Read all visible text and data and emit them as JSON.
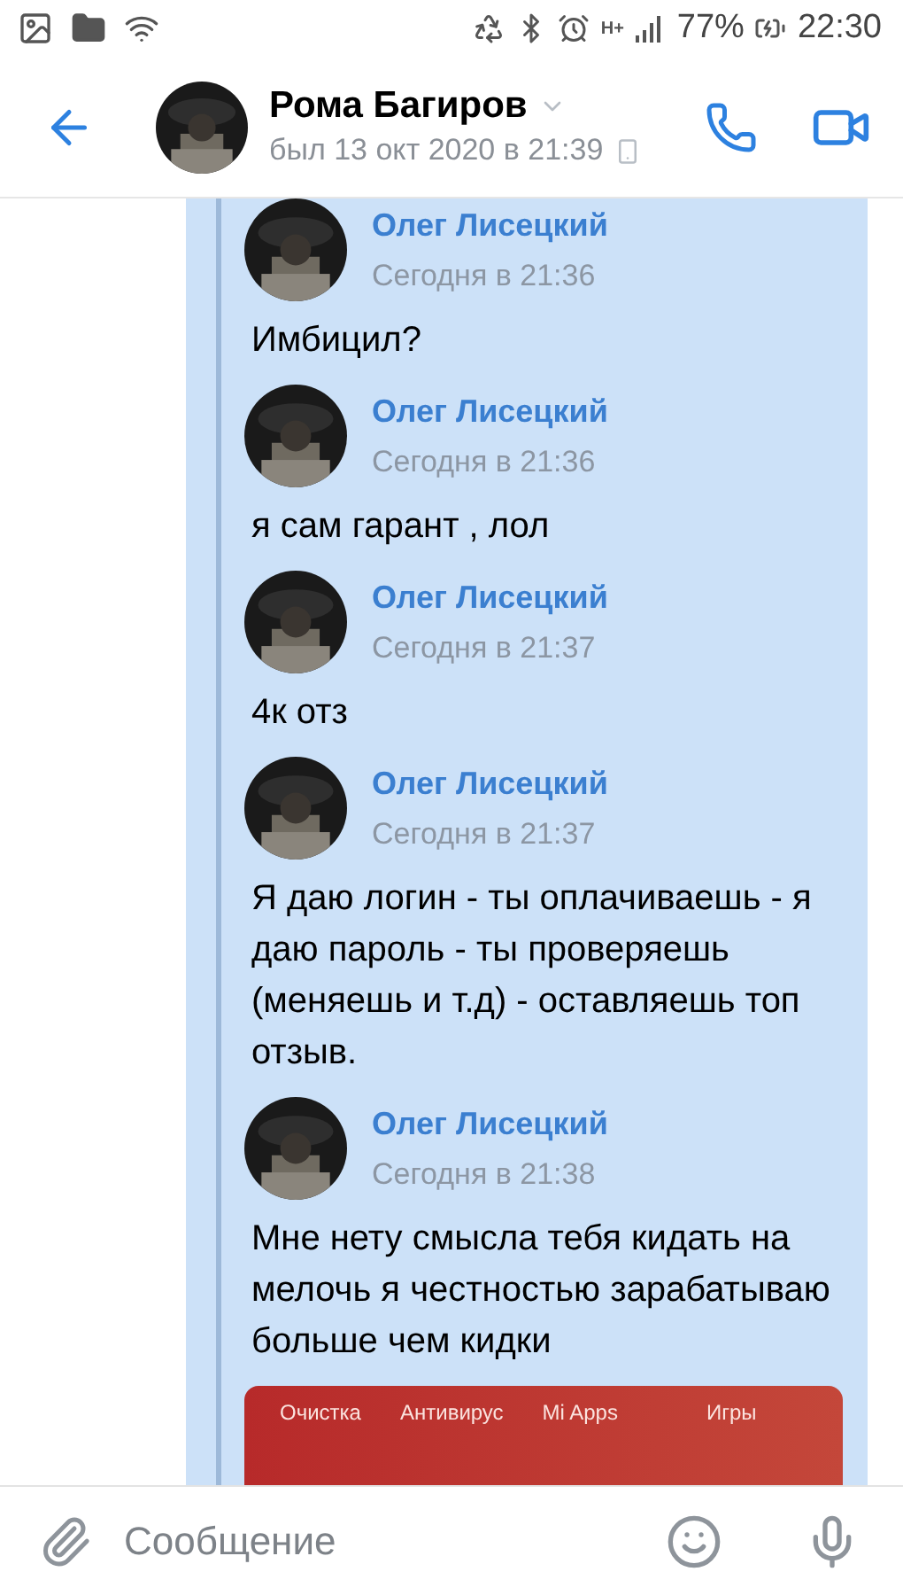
{
  "status_bar": {
    "network": "H+",
    "battery": "77%",
    "time": "22:30"
  },
  "header": {
    "name": "Рома Багиров",
    "last_seen": "был 13 окт 2020 в 21:39"
  },
  "forwarded": [
    {
      "author": "Олег Лисецкий",
      "time": "Сегодня в 21:36",
      "text": "Имбицил?"
    },
    {
      "author": "Олег Лисецкий",
      "time": "Сегодня в 21:36",
      "text": "я сам гарант , лол"
    },
    {
      "author": "Олег Лисецкий",
      "time": "Сегодня в 21:37",
      "text": "4к отз"
    },
    {
      "author": "Олег Лисецкий",
      "time": "Сегодня в 21:37",
      "text": "Я даю логин - ты оплачиваешь - я даю пароль - ты проверяешь (меняешь и т.д) - оставляешь топ отзыв."
    },
    {
      "author": "Олег Лисецкий",
      "time": "Сегодня в 21:38",
      "text": "Мне нету смысла тебя кидать на мелочь я честностью зарабатываю больше чем кидки"
    }
  ],
  "attached_screenshot": {
    "tabs": [
      "Очистка",
      "Антивирус",
      "Mi Apps",
      "Игры"
    ]
  },
  "composer": {
    "placeholder": "Сообщение"
  }
}
